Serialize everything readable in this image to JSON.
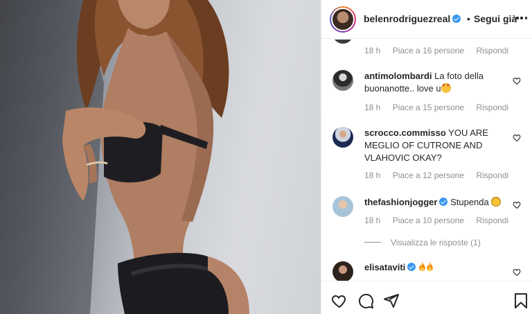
{
  "post": {
    "username": "belenrodriguezreal",
    "follow_label": "Segui già",
    "follow_separator": "•",
    "verified": true
  },
  "first_meta": {
    "time": "18 h",
    "likes": "Piace a 16 persone",
    "reply": "Rispondi"
  },
  "comments": [
    {
      "username": "antimolombardi",
      "text": "La foto della buonanotte.. love u",
      "emoji": "heart-eyes-emoji",
      "time": "18 h",
      "likes": "Piace a 15 persone",
      "reply": "Rispondi"
    },
    {
      "username": "scrocco.commisso",
      "text": "YOU ARE MEGLIO OF CUTRONE AND VLAHOVIC OKAY?",
      "time": "18 h",
      "likes": "Piace a 12 persone",
      "reply": "Rispondi"
    },
    {
      "username": "thefashionjogger",
      "text": "Stupenda",
      "verified": true,
      "emoji": "smile-emoji",
      "time": "18 h",
      "likes": "Piace a 10 persone",
      "reply": "Rispondi",
      "view_replies": "Visualizza le risposte (1)"
    },
    {
      "username": "elisataviti",
      "text": "",
      "verified": true,
      "emoji": "fire-emoji-x2"
    }
  ],
  "icons": {
    "like": "heart-icon",
    "comment": "comment-icon",
    "share": "paper-plane-icon",
    "save": "bookmark-icon",
    "more": "more-dots-icon"
  },
  "colors": {
    "verified_blue": "#3897f0",
    "meta_gray": "#8e8e8e",
    "text": "#262626"
  }
}
